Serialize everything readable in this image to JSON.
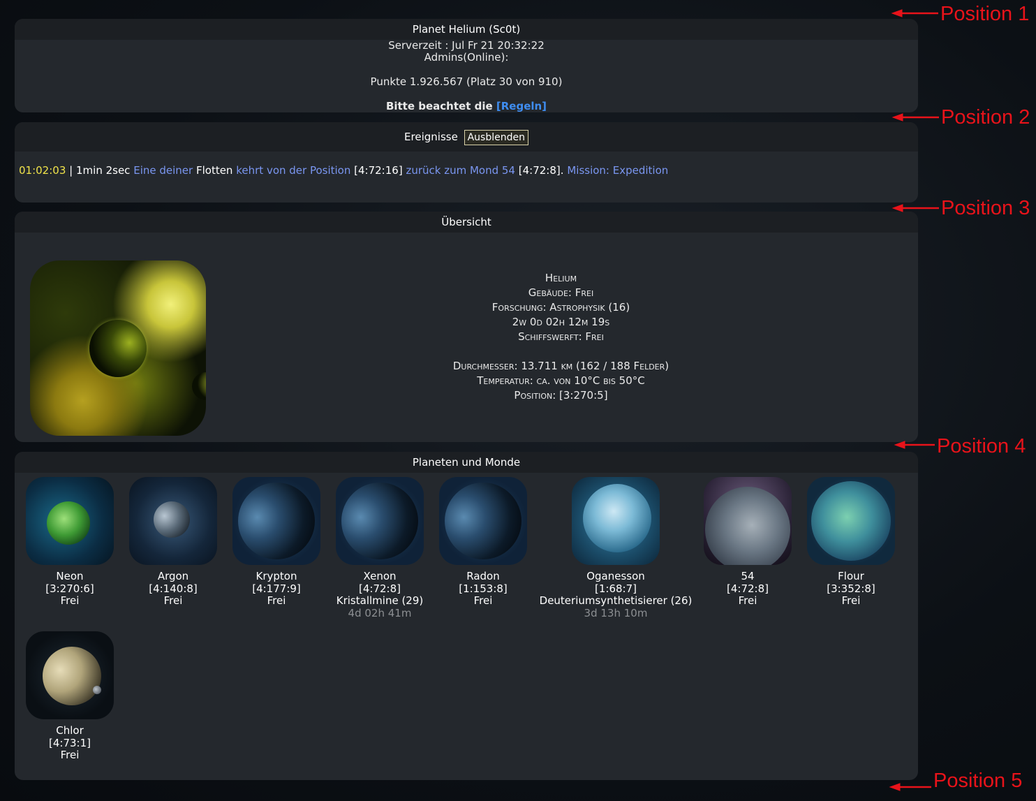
{
  "header": {
    "title": "Planet Helium (Sc0t)",
    "server_time": "Serverzeit : Jul Fr 21 20:32:22",
    "admins": "Admins(Online):",
    "points": "Punkte 1.926.567 (Platz 30 von 910)",
    "rules_prefix": "Bitte beachtet die",
    "rules_link": "[Regeln]"
  },
  "events": {
    "title": "Ereignisse",
    "hide_button": "Ausblenden",
    "items": [
      {
        "time": "01:02:03",
        "sep": "|",
        "duration": "1min 2sec",
        "text_1": "Eine deiner",
        "fleets": "Flotten",
        "text_2": "kehrt von der Position",
        "from": "[4:72:16]",
        "text_3": "zurück zum Mond 54",
        "to": "[4:72:8]",
        "dot": ".",
        "mission": "Mission: Expedition"
      }
    ]
  },
  "overview": {
    "title": "Übersicht",
    "planet_name": "Helium",
    "buildings": "Gebäude: Frei",
    "research": "Forschung: Astrophysik (16)",
    "research_time": "2w 0d 02h 12m 19s",
    "shipyard": "Schiffswerft: Frei",
    "diameter": "Durchmesser: 13.711 km (162 / 188 Felder)",
    "temperature": "Temperatur: ca. von 10°C bis 50°C",
    "position": "Position: [3:270:5]"
  },
  "planets": {
    "title": "Planeten und Monde",
    "items": [
      {
        "name": "Neon",
        "coords": "[3:270:6]",
        "status": "Frei",
        "time": ""
      },
      {
        "name": "Argon",
        "coords": "[4:140:8]",
        "status": "Frei",
        "time": ""
      },
      {
        "name": "Krypton",
        "coords": "[4:177:9]",
        "status": "Frei",
        "time": ""
      },
      {
        "name": "Xenon",
        "coords": "[4:72:8]",
        "status": "Kristallmine (29)",
        "time": "4d 02h 41m"
      },
      {
        "name": "Radon",
        "coords": "[1:153:8]",
        "status": "Frei",
        "time": ""
      },
      {
        "name": "Oganesson",
        "coords": "[1:68:7]",
        "status": "Deuteriumsynthetisierer (26)",
        "time": "3d 13h 10m"
      },
      {
        "name": "54",
        "coords": "[4:72:8]",
        "status": "Frei",
        "time": ""
      },
      {
        "name": "Flour",
        "coords": "[3:352:8]",
        "status": "Frei",
        "time": ""
      },
      {
        "name": "Chlor",
        "coords": "[4:73:1]",
        "status": "Frei",
        "time": ""
      }
    ]
  },
  "annotations": [
    "Position 1",
    "Position 2",
    "Position 3",
    "Position 4",
    "Position 5"
  ],
  "colors": {
    "panel_bg": "#24282d",
    "panel_head_bg": "#1c1f23",
    "link": "#3f8df0",
    "event_time": "#f0e34a",
    "event_blue": "#7a96f0",
    "annotation": "#e8131a"
  }
}
